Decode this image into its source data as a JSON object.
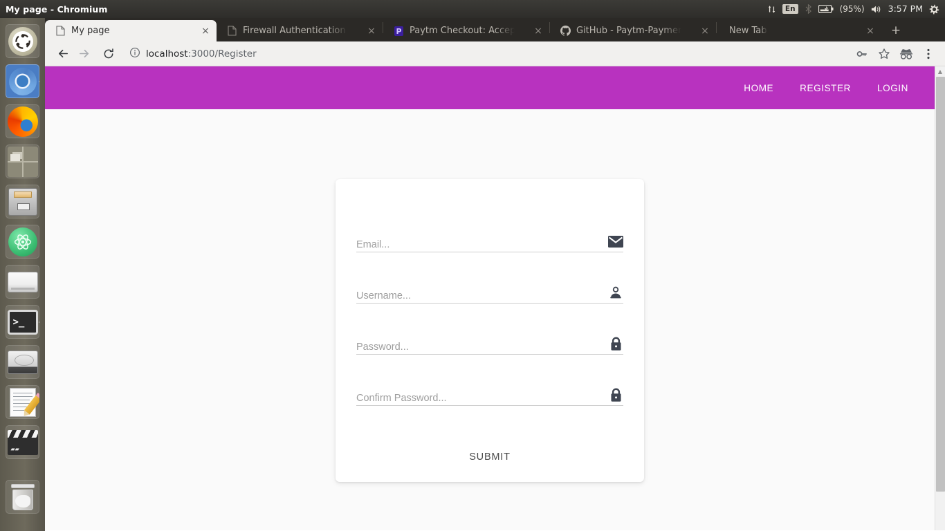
{
  "system": {
    "window_title": "My page - Chromium",
    "tray": {
      "network_icon": "network-updown-icon",
      "keyboard_layout": "En",
      "bluetooth_icon": "bluetooth-icon",
      "battery_icon": "battery-icon",
      "battery_label": "(95%)",
      "volume_icon": "volume-icon",
      "clock": "3:57 PM",
      "settings_icon": "gear-power-icon"
    },
    "launcher": [
      {
        "name": "ubuntu-dash-icon",
        "label": "Ubuntu Dash"
      },
      {
        "name": "chromium-icon",
        "label": "Chromium Web Browser"
      },
      {
        "name": "firefox-icon",
        "label": "Firefox Web Browser"
      },
      {
        "name": "workspace-switcher-icon",
        "label": "Workspace Switcher"
      },
      {
        "name": "files-icon",
        "label": "Files"
      },
      {
        "name": "atom-icon",
        "label": "Atom"
      },
      {
        "name": "floppy-disk-icon",
        "label": "Disk"
      },
      {
        "name": "terminal-icon",
        "label": "Terminal"
      },
      {
        "name": "hard-disk-icon",
        "label": "Hard Disk"
      },
      {
        "name": "text-editor-icon",
        "label": "Text Editor"
      },
      {
        "name": "video-player-icon",
        "label": "Video Player"
      },
      {
        "name": "trash-icon",
        "label": "Trash"
      }
    ]
  },
  "browser": {
    "tabs": [
      {
        "title": "My page",
        "favicon": "page-icon",
        "active": true,
        "closable": true
      },
      {
        "title": "Firewall Authentication K",
        "favicon": "page-icon",
        "active": false,
        "closable": true
      },
      {
        "title": "Paytm Checkout: Accept P",
        "favicon": "paytm-icon",
        "active": false,
        "closable": true
      },
      {
        "title": "GitHub - Paytm-Payments",
        "favicon": "github-icon",
        "active": false,
        "closable": true
      },
      {
        "title": "New Tab",
        "favicon": "none",
        "active": false,
        "closable": true
      }
    ],
    "new_tab_label": "+",
    "close_glyph": "×",
    "toolbar": {
      "back_icon": "back-arrow-icon",
      "forward_icon": "forward-arrow-icon",
      "reload_icon": "reload-icon",
      "info_icon": "page-info-icon",
      "url_host": "localhost",
      "url_path": ":3000/Register",
      "url_full": "localhost:3000/Register",
      "password_icon": "key-icon",
      "bookmark_icon": "star-icon",
      "incognito_icon": "incognito-icon",
      "menu_icon": "three-dot-menu-icon"
    },
    "scrollbar": {
      "up_arrow": "▲"
    }
  },
  "webpage": {
    "navbar": {
      "background_color": "#b832bf",
      "links": [
        {
          "label": "HOME",
          "name": "nav-link-home"
        },
        {
          "label": "REGISTER",
          "name": "nav-link-register"
        },
        {
          "label": "LOGIN",
          "name": "nav-link-login"
        }
      ]
    },
    "register_form": {
      "fields": [
        {
          "name": "email-field",
          "placeholder": "Email...",
          "value": "",
          "type": "text",
          "icon": "envelope-icon"
        },
        {
          "name": "username-field",
          "placeholder": "Username...",
          "value": "",
          "type": "text",
          "icon": "person-icon"
        },
        {
          "name": "password-field",
          "placeholder": "Password...",
          "value": "",
          "type": "password",
          "icon": "lock-icon"
        },
        {
          "name": "confirm-password-field",
          "placeholder": "Confirm Password...",
          "value": "",
          "type": "password",
          "icon": "lock-icon"
        }
      ],
      "submit_label": "SUBMIT"
    },
    "background_color": "#fafafa",
    "card_color": "#ffffff"
  }
}
